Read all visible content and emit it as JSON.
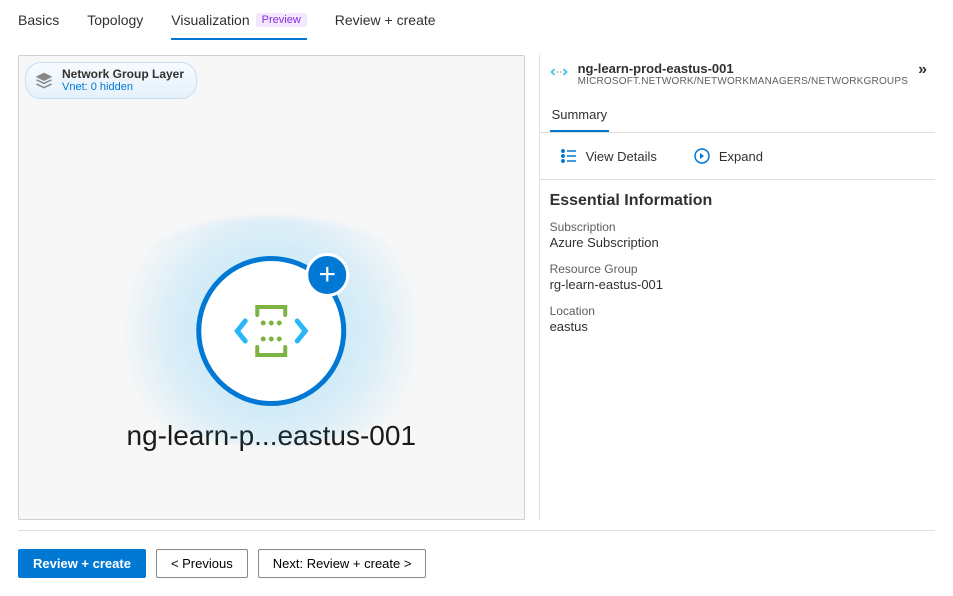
{
  "tabs": {
    "basics": "Basics",
    "topology": "Topology",
    "visualization": "Visualization",
    "preview_tag": "Preview",
    "review": "Review + create"
  },
  "layer": {
    "title": "Network Group Layer",
    "subtitle": "Vnet: 0 hidden"
  },
  "node": {
    "label": "ng-learn-p...eastus-001"
  },
  "panel": {
    "title": "ng-learn-prod-eastus-001",
    "subtitle": "MICROSOFT.NETWORK/NETWORKMANAGERS/NETWORKGROUPS",
    "tab_summary": "Summary",
    "action_view_details": "View Details",
    "action_expand": "Expand",
    "section_essential": "Essential Information",
    "subscription_label": "Subscription",
    "subscription_value": "Azure Subscription",
    "rg_label": "Resource Group",
    "rg_value": "rg-learn-eastus-001",
    "location_label": "Location",
    "location_value": "eastus"
  },
  "footer": {
    "review": "Review + create",
    "previous": "<  Previous",
    "next": "Next: Review + create  >"
  }
}
